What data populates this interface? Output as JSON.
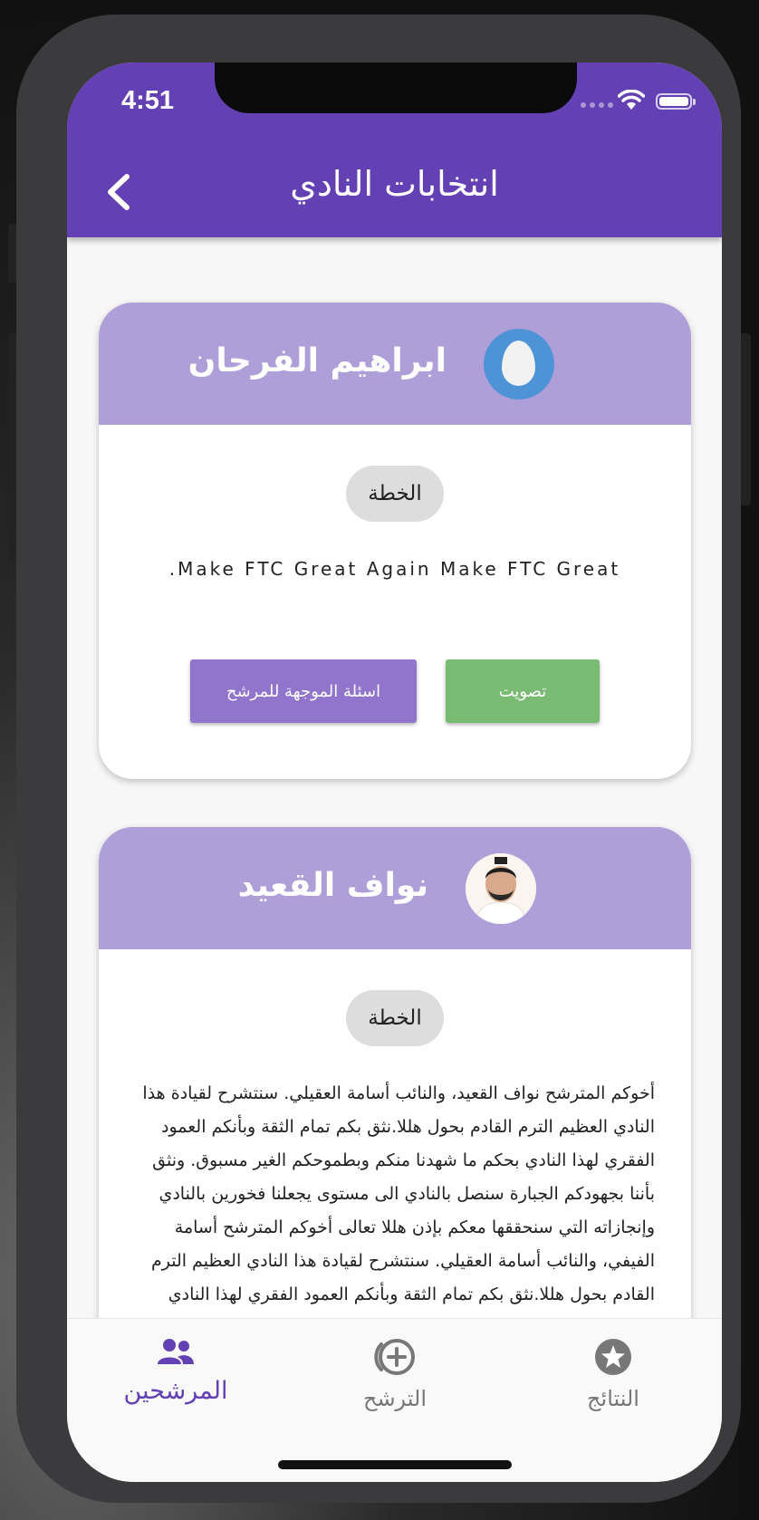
{
  "status_bar": {
    "time": "4:51"
  },
  "header": {
    "title": "انتخابات النادي"
  },
  "candidates": [
    {
      "name": "ابراهيم الفرحان",
      "plan_label": "الخطة",
      "plan_text": ".Make FTC Great Again Make FTC Great",
      "questions_button": "اسئلة الموجهة للمرشح",
      "vote_button": "تصويت"
    },
    {
      "name": "نواف القعيد",
      "plan_label": "الخطة",
      "plan_text": "أخوكم المترشح نواف القعيد، والنائب أسامة العقيلي. سنتشرح لقيادة هذا النادي العظيم الترم القادم بحول هللا.نثق بكم تمام الثقة وبأنكم العمود الفقري لهذا النادي بحكم ما شهدنا منكم وبطموحكم الغير مسبوق. ونثق بأننا بجهودكم الجبارة سنصل بالنادي الى مستوى يجعلنا فخورين بالنادي وإنجازاته التي سنحققها معكم بإذن هللا تعالى أخوكم المترشح أسامة الفيفي، والنائب أسامة العقيلي. سنتشرح لقيادة هذا النادي العظيم الترم القادم بحول هللا.نثق بكم تمام الثقة وبأنكم العمود الفقري لهذا النادي"
    }
  ],
  "tabs": [
    {
      "label": "المرشحين",
      "icon": "people-icon",
      "active": true
    },
    {
      "label": "الترشح",
      "icon": "add-circle-icon",
      "active": false
    },
    {
      "label": "النتائج",
      "icon": "star-circle-icon",
      "active": false
    }
  ],
  "colors": {
    "primary": "#6340b3",
    "card_header": "#ae9fd9",
    "questions_button": "#9175cc",
    "vote_button": "#7abb73"
  }
}
